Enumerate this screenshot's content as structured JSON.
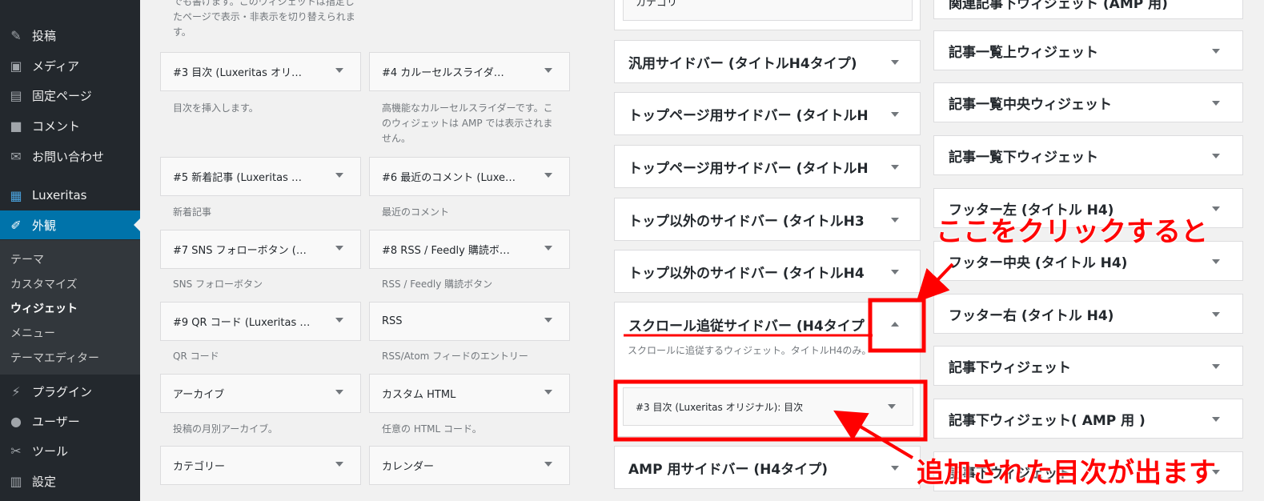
{
  "sidebar": {
    "items": [
      {
        "label": "投稿",
        "icon": "pin-icon"
      },
      {
        "label": "メディア",
        "icon": "media-icon"
      },
      {
        "label": "固定ページ",
        "icon": "page-icon"
      },
      {
        "label": "コメント",
        "icon": "comment-icon"
      },
      {
        "label": "お問い合わせ",
        "icon": "mail-icon"
      },
      {
        "label": "Luxeritas",
        "icon": "grid-icon"
      },
      {
        "label": "外観",
        "icon": "brush-icon"
      },
      {
        "label": "プラグイン",
        "icon": "plugin-icon"
      },
      {
        "label": "ユーザー",
        "icon": "user-icon"
      },
      {
        "label": "ツール",
        "icon": "wrench-icon"
      },
      {
        "label": "設定",
        "icon": "settings-icon"
      }
    ],
    "submenu": [
      "テーマ",
      "カスタマイズ",
      "ウィジェット",
      "メニュー",
      "テーマエディター"
    ]
  },
  "available": {
    "top_desc": "でも書けます。このウィジェットは指定したページで表示・非表示を切り替えられます。",
    "widgets": [
      {
        "title": "#3 目次 (Luxeritas オリ…",
        "desc": "目次を挿入します。"
      },
      {
        "title": "#4 カルーセルスライダ…",
        "desc": "高機能なカルーセルスライダーです。このウィジェットは AMP では表示されません。"
      },
      {
        "title": "#5 新着記事 (Luxeritas …",
        "desc": "新着記事"
      },
      {
        "title": "#6 最近のコメント (Luxe…",
        "desc": "最近のコメント"
      },
      {
        "title": "#7 SNS フォローボタン (…",
        "desc": "SNS フォローボタン"
      },
      {
        "title": "#8 RSS / Feedly 購読ボ…",
        "desc": "RSS / Feedly 購読ボタン"
      },
      {
        "title": "#9 QR コード (Luxeritas …",
        "desc": "QR コード"
      },
      {
        "title": "RSS",
        "desc": "RSS/Atom フィードのエントリー"
      },
      {
        "title": "アーカイブ",
        "desc": "投稿の月別アーカイブ。"
      },
      {
        "title": "カスタム HTML",
        "desc": "任意の HTML コード。"
      },
      {
        "title": "カテゴリー",
        "desc": ""
      },
      {
        "title": "カレンダー",
        "desc": ""
      }
    ]
  },
  "sidebars_col1": {
    "top_partial": "カテゴリ",
    "items": [
      "汎用サイドバー (タイトルH4タイプ)",
      "トップページ用サイドバー (タイトルH",
      "トップページ用サイドバー (タイトルH",
      "トップ以外のサイドバー (タイトルH3",
      "トップ以外のサイドバー (タイトルH4"
    ],
    "open": {
      "title": "スクロール追従サイドバー (H4タイプ",
      "desc": "スクロールに追従するウィジェット。タイトルH4のみ。",
      "widget": "#3 目次 (Luxeritas オリジナル): 目次"
    },
    "last": "AMP 用サイドバー (H4タイプ)"
  },
  "sidebars_col2": {
    "top_partial": "関連記事下ウィジェット (AMP 用)",
    "items": [
      "記事一覧上ウィジェット",
      "記事一覧中央ウィジェット",
      "記事一覧下ウィジェット",
      "フッター左 (タイトル H4)",
      "フッター中央 (タイトル H4)",
      "フッター右 (タイトル H4)",
      "記事下ウィジェット",
      "記事下ウィジェット( AMP 用 )",
      "記事下ウィジェット"
    ]
  },
  "annotations": {
    "click_here": "ここをクリックすると",
    "appears": "追加された目次が出ます",
    "color": "#ff0000"
  }
}
